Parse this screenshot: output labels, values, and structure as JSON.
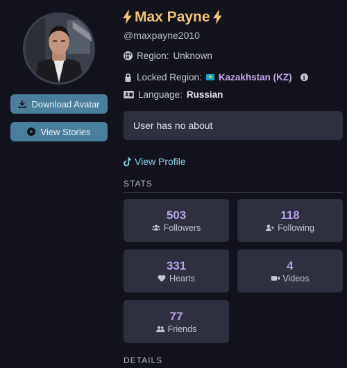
{
  "profile": {
    "display_name": "Max Payne",
    "handle": "@maxpayne2010",
    "region_label": "Region:",
    "region_value": "Unknown",
    "locked_region_label": "Locked Region:",
    "locked_region_value": "Kazakhstan (KZ)",
    "language_label": "Language:",
    "language_value": "Russian",
    "about": "User has no about",
    "view_profile": "View Profile"
  },
  "actions": {
    "download_avatar": "Download Avatar",
    "view_stories": "View Stories"
  },
  "sections": {
    "stats": "STATS",
    "details": "DETAILS"
  },
  "stats": [
    {
      "value": "503",
      "label": "Followers",
      "icon": "users-icon"
    },
    {
      "value": "118",
      "label": "Following",
      "icon": "user-plus-icon"
    },
    {
      "value": "331",
      "label": "Hearts",
      "icon": "heart-icon"
    },
    {
      "value": "4",
      "label": "Videos",
      "icon": "video-icon"
    },
    {
      "value": "77",
      "label": "Friends",
      "icon": "user-friends-icon"
    }
  ],
  "colors": {
    "background": "#12131c",
    "card": "#2e2f3f",
    "name_accent": "#f2c27a",
    "stat_number": "#b9a4e6",
    "region_accent": "#c3a9ee",
    "button": "#4a7f9b",
    "link": "#8fd0e6"
  }
}
